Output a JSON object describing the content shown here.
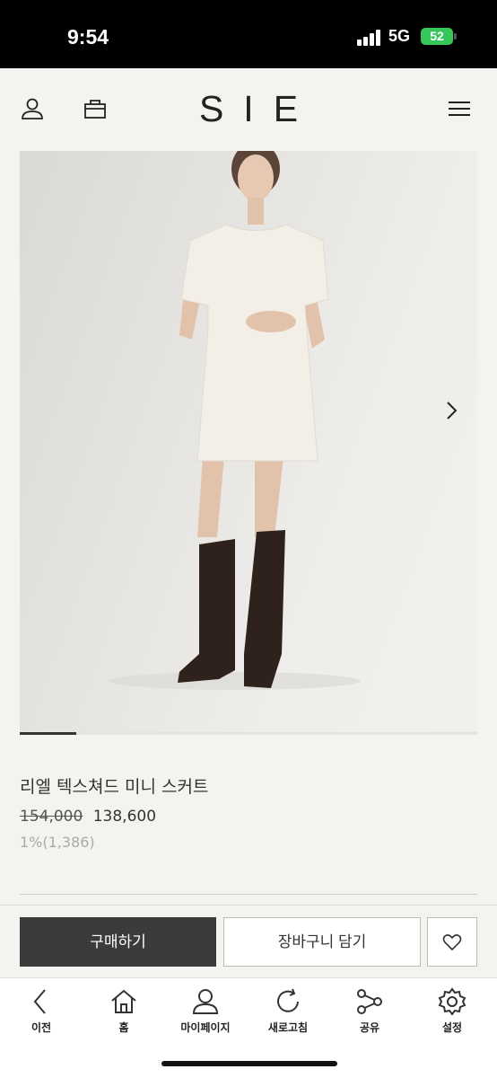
{
  "status_bar": {
    "time": "9:54",
    "network": "5G",
    "battery": "52"
  },
  "header": {
    "logo": "SIE"
  },
  "icons": {
    "account": "user-icon",
    "bag": "shopping-bag-icon",
    "menu": "hamburger-menu-icon",
    "next": "chevron-right-icon",
    "wish": "heart-icon"
  },
  "gallery": {
    "current_index": 1,
    "total_fraction_shown": 0.125
  },
  "product": {
    "name": "리엘 텍스쳐드 미니 스커트",
    "original_price": "154,000",
    "sale_price": "138,600",
    "points": "1%(1,386)"
  },
  "actions": {
    "buy_label": "구매하기",
    "cart_label": "장바구니 담기"
  },
  "bottom_nav": [
    {
      "label": "이전",
      "icon": "back-arrow-icon"
    },
    {
      "label": "홈",
      "icon": "home-icon"
    },
    {
      "label": "마이페이지",
      "icon": "user-icon"
    },
    {
      "label": "새로고침",
      "icon": "refresh-icon"
    },
    {
      "label": "공유",
      "icon": "share-icon"
    },
    {
      "label": "설정",
      "icon": "gear-icon"
    }
  ],
  "colors": {
    "background": "#f4f3ef",
    "buy_button": "#3b3b3b",
    "battery": "#35c759"
  }
}
